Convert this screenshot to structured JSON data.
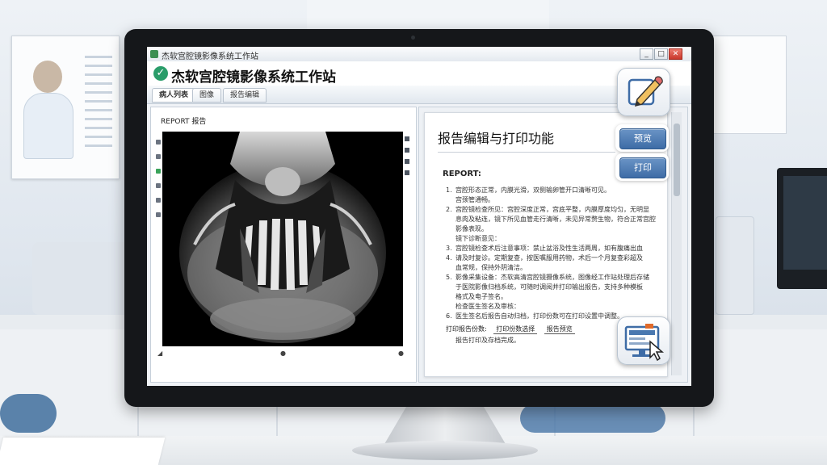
{
  "window": {
    "title": "杰软宫腔镜影像系统工作站",
    "controls": [
      "_",
      "□",
      "✕"
    ]
  },
  "header": {
    "title": "杰软宫腔镜影像系统工作站"
  },
  "tabs": [
    {
      "label": "病人列表"
    },
    {
      "label": "图像"
    },
    {
      "label": "报告编辑"
    }
  ],
  "image_panel": {
    "report_label": "REPORT 报告"
  },
  "report_panel": {
    "heading": "报告编辑与打印功能",
    "report_title": "REPORT:",
    "lines": [
      {
        "num": "1.",
        "text": "宫腔形态正常，内膜光滑，双侧输卵管开口清晰可见。"
      },
      {
        "num": "",
        "text": "宫颈管通畅。"
      },
      {
        "num": "2.",
        "text": "宫腔镜检查所见：宫腔深度正常，宫底平整，内膜厚度均匀，无明显"
      },
      {
        "num": "",
        "text": "息肉及粘连，镜下所见血管走行清晰，未见异常赘生物，符合正常宫腔"
      },
      {
        "num": "",
        "text": "影像表现。"
      },
      {
        "num": "",
        "text": "镜下诊断意见："
      },
      {
        "num": "3.",
        "text": "宫腔镜检查术后注意事项：禁止盆浴及性生活两周，如有腹痛出血"
      },
      {
        "num": "4.",
        "text": "请及时复诊。定期复查，按医嘱服用药物，术后一个月复查彩超及"
      },
      {
        "num": "",
        "text": "血常规，保持外阴清洁。"
      },
      {
        "num": "5.",
        "text": "影像采集设备：杰软高清宫腔镜摄像系统，图像经工作站处理后存储"
      },
      {
        "num": "",
        "text": "于医院影像归档系统，可随时调阅并打印输出报告，支持多种模板"
      },
      {
        "num": "",
        "text": "格式及电子签名。"
      },
      {
        "num": "",
        "text": "检查医生签名及审核："
      },
      {
        "num": "6.",
        "text": "医生签名后报告自动归档，打印份数可在打印设置中调整。"
      },
      {
        "num": "",
        "text": "报告打印及存档完成。"
      }
    ],
    "footer_label": "打印报告份数:",
    "footer_boxes": [
      "打印份数选择",
      "报告预览"
    ]
  },
  "buttons": {
    "preview": "预览",
    "print": "打印"
  },
  "icons": {
    "edit": "pencil-edit-icon",
    "computer": "computer-print-icon",
    "check": "check-circle-icon"
  },
  "colors": {
    "accent_blue": "#4a78b0",
    "check_green": "#2a9d6a"
  }
}
